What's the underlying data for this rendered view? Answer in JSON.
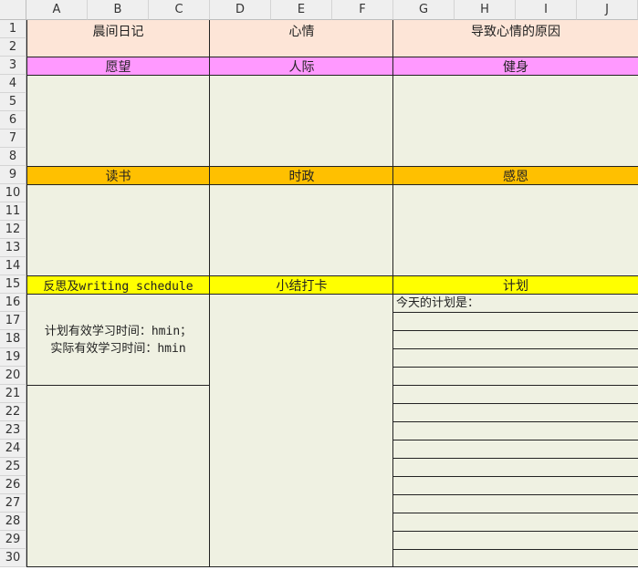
{
  "columns": [
    "A",
    "B",
    "C",
    "D",
    "E",
    "F",
    "G",
    "H",
    "I",
    "J"
  ],
  "rows": [
    "1",
    "2",
    "3",
    "4",
    "5",
    "6",
    "7",
    "8",
    "9",
    "10",
    "11",
    "12",
    "13",
    "14",
    "15",
    "16",
    "17",
    "18",
    "19",
    "20",
    "21",
    "22",
    "23",
    "24",
    "25",
    "26",
    "27",
    "28",
    "29",
    "30"
  ],
  "header_row": {
    "morning_diary": "晨间日记",
    "mood": "心情",
    "mood_reason": "导致心情的原因"
  },
  "section_row_3": {
    "wish": "愿望",
    "social": "人际",
    "fitness": "健身"
  },
  "section_row_9": {
    "reading": "读书",
    "current_affairs": "时政",
    "gratitude": "感恩"
  },
  "section_row_15": {
    "reflection": "反思及writing schedule",
    "summary_checkin": "小结打卡",
    "plan": "计划"
  },
  "study_time": {
    "planned": "计划有效学习时间：hmin；",
    "actual": "实际有效学习时间：hmin"
  },
  "plan_prompt": "今天的计划是：",
  "colors": {
    "pink": "#fde5d7",
    "magenta": "#ff99ff",
    "orange": "#ffc000",
    "yellow": "#ffff00",
    "cell_bg": "#eff1e2"
  }
}
